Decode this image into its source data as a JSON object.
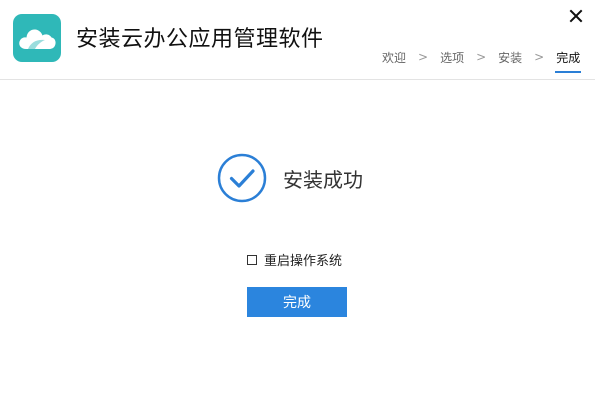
{
  "header": {
    "app_title": "安装云办公应用管理软件",
    "logo_icon": "cloud-icon",
    "close_icon": "close-icon"
  },
  "steps": [
    {
      "label": "欢迎",
      "active": false
    },
    {
      "label": "选项",
      "active": false
    },
    {
      "label": "安装",
      "active": false
    },
    {
      "label": "完成",
      "active": true
    }
  ],
  "step_separator": ">",
  "main": {
    "success_icon": "check-circle-icon",
    "success_text": "安装成功",
    "reboot_label": "重启操作系统",
    "reboot_checked": false,
    "finish_button": "完成"
  },
  "colors": {
    "logo": "#2fb8b8",
    "accent": "#2b85de",
    "check": "#2b7fd6"
  }
}
